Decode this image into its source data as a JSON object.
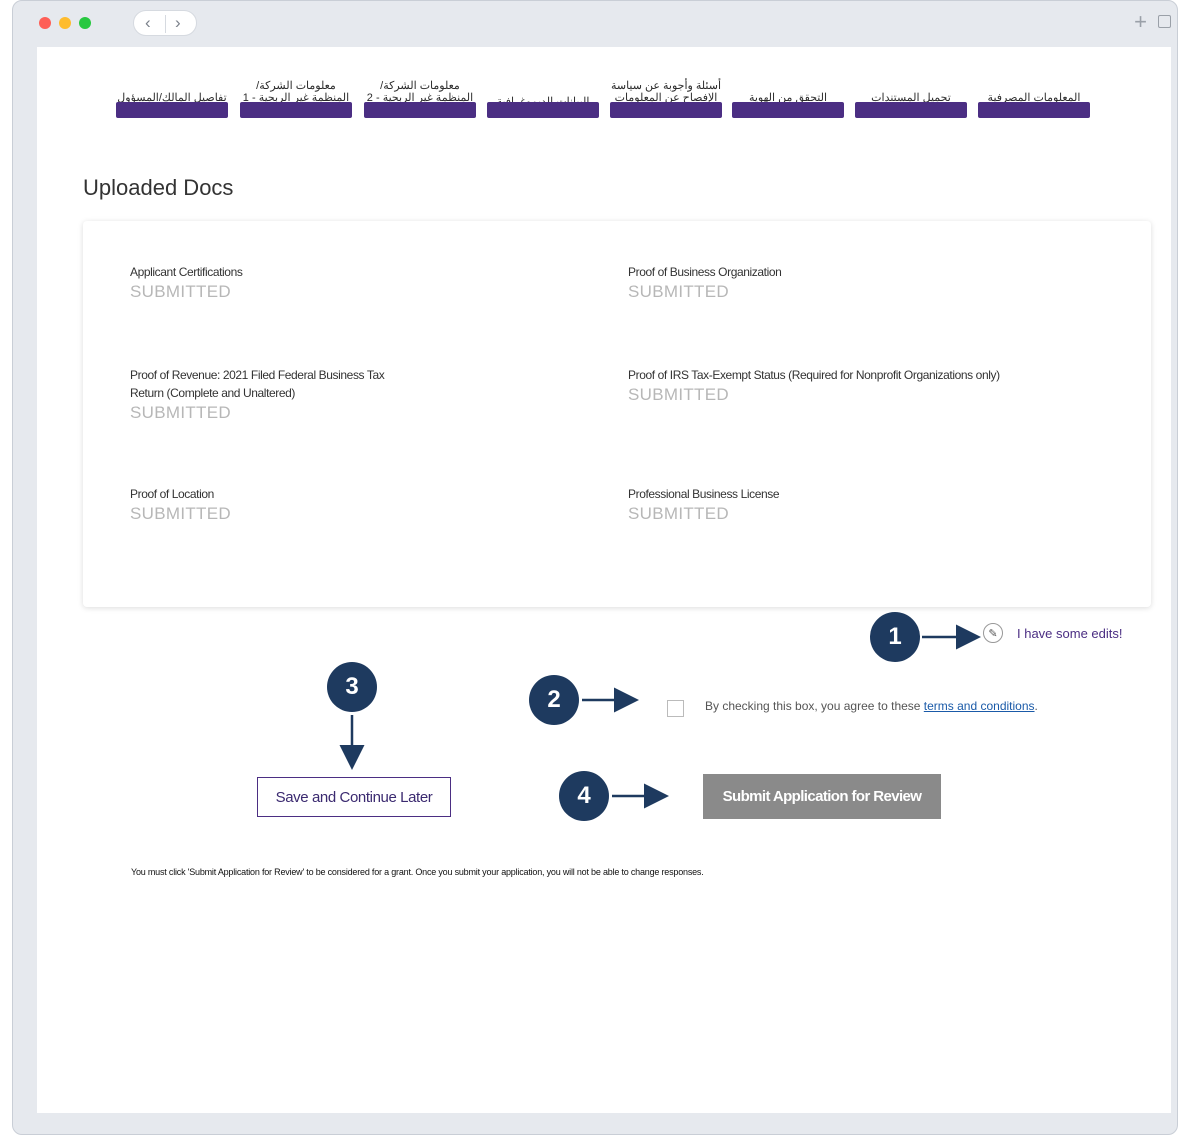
{
  "steps": [
    {
      "label": "تفاصيل المالك/المسؤول"
    },
    {
      "label": "معلومات الشركة/المنظمة غير الربحية - 1"
    },
    {
      "label": "معلومات الشركة/المنظمة غير الربحية - 2"
    },
    {
      "label": "البيانات الديموغرافية"
    },
    {
      "label": "أسئلة وأجوبة عن سياسة الإفصاح عن المعلومات"
    },
    {
      "label": "التحقق من الهوية"
    },
    {
      "label": "تحميل المستندات"
    },
    {
      "label": "المعلومات المصرفية"
    }
  ],
  "section_title": "Uploaded Docs",
  "docs": [
    {
      "name": "Applicant Certifications",
      "status": "SUBMITTED"
    },
    {
      "name": "Proof of Business Organization",
      "status": "SUBMITTED"
    },
    {
      "name": "Proof of Revenue: 2021 Filed Federal Business Tax Return (Complete and Unaltered)",
      "status": "SUBMITTED"
    },
    {
      "name": "Proof of IRS Tax-Exempt Status (Required for Nonprofit Organizations only)",
      "status": "SUBMITTED"
    },
    {
      "name": "Proof of Location",
      "status": "SUBMITTED"
    },
    {
      "name": "Professional Business License",
      "status": "SUBMITTED"
    }
  ],
  "edit_link": "I have some edits!",
  "agree": {
    "text": "By checking this box, you agree to these ",
    "link": "terms and conditions",
    "end": "."
  },
  "buttons": {
    "save": "Save and Continue Later",
    "submit": "Submit Application for Review"
  },
  "note": "You must click 'Submit Application for Review' to be considered for a grant. Once you submit your application, you will not be able to change responses.",
  "callouts": [
    "1",
    "2",
    "3",
    "4"
  ],
  "colors": {
    "primary": "#4b2e83",
    "badge": "#1e3a5f",
    "submit_disabled": "#8a8a8a",
    "status": "#b7b7b7"
  }
}
